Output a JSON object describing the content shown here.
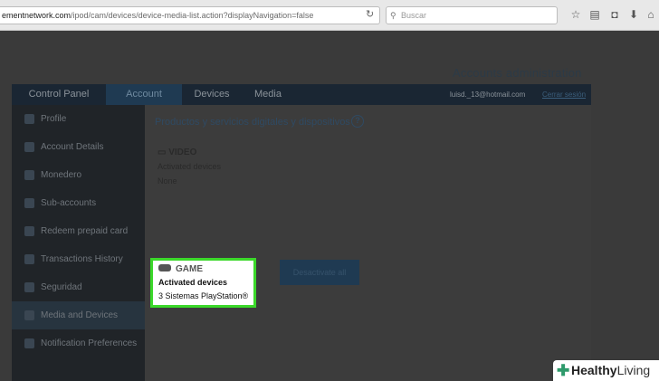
{
  "browser": {
    "url_host": "ementnetwork.com",
    "url_path": "/ipod/cam/devices/device-media-list.action?displayNavigation=false",
    "search_placeholder": "Buscar"
  },
  "page": {
    "admin_title": "Accounts administration"
  },
  "nav": {
    "items": [
      "Control Panel",
      "Account",
      "Devices",
      "Media"
    ],
    "active": "Account",
    "user_email": "luisd._13@hotmail.com",
    "logout_label": "Cerrar sesión"
  },
  "sidebar": {
    "items": [
      {
        "label": "Profile"
      },
      {
        "label": "Account Details"
      },
      {
        "label": "Monedero"
      },
      {
        "label": "Sub-accounts"
      },
      {
        "label": "Redeem prepaid card"
      },
      {
        "label": "Transactions History"
      },
      {
        "label": "Seguridad"
      },
      {
        "label": "Media and Devices"
      },
      {
        "label": "Notification Preferences"
      }
    ],
    "active": "Media and Devices"
  },
  "content": {
    "title": "Productos y servicios digitales y dispositivos",
    "help": "?",
    "video": {
      "heading": "VIDEO",
      "sub": "Activated devices",
      "value": "None"
    },
    "game": {
      "heading": "GAME",
      "sub": "Activated devices",
      "value": "3 Sistemas PlayStation®"
    },
    "deactivate_label": "Desactivate all"
  },
  "watermark": {
    "brand_a": "Healthy",
    "brand_b": "Living"
  },
  "colors": {
    "highlight": "#3bd82a",
    "nav_bg": "#1a2633"
  }
}
